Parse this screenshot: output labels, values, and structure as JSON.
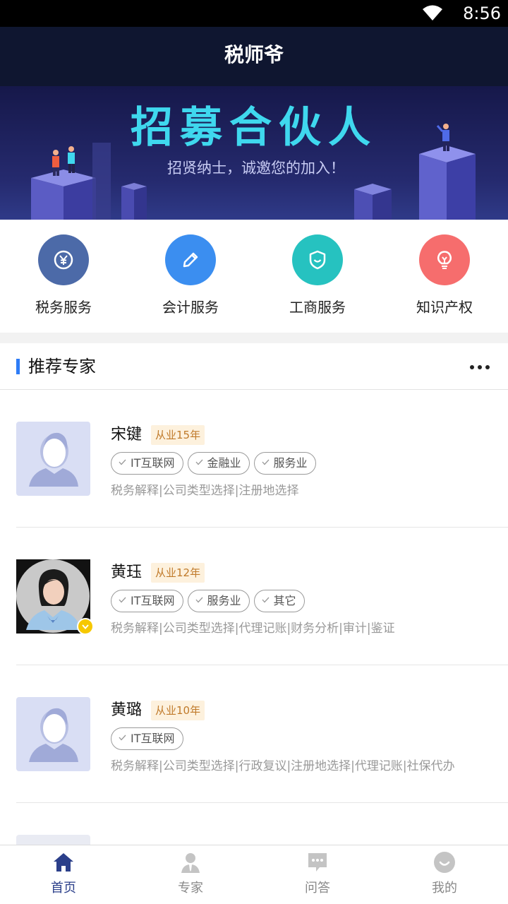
{
  "status": {
    "time": "8:56",
    "wifi_icon": "wifi-icon"
  },
  "header": {
    "title": "税师爷"
  },
  "banner": {
    "headline": "招募合伙人",
    "subline": "招贤纳士，诚邀您的加入！"
  },
  "services": [
    {
      "label": "税务服务",
      "icon": "yen-icon",
      "color": "#4c6aa8"
    },
    {
      "label": "会计服务",
      "icon": "pencil-icon",
      "color": "#3b8ef0"
    },
    {
      "label": "工商服务",
      "icon": "shield-icon",
      "color": "#26c2c0"
    },
    {
      "label": "知识产权",
      "icon": "lightbulb-icon",
      "color": "#f66d6d"
    }
  ],
  "experts_section": {
    "title": "推荐专家",
    "more_icon": "more-icon"
  },
  "experts": [
    {
      "name": "宋键",
      "years": "从业15年",
      "tags": [
        "IT互联网",
        "金融业",
        "服务业"
      ],
      "desc": "税务解释|公司类型选择|注册地选择"
    },
    {
      "name": "黄珏",
      "years": "从业12年",
      "tags": [
        "IT互联网",
        "服务业",
        "其它"
      ],
      "desc": "税务解释|公司类型选择|代理记账|财务分析|审计|鉴证"
    },
    {
      "name": "黄璐",
      "years": "从业10年",
      "tags": [
        "IT互联网"
      ],
      "desc": "税务解释|公司类型选择|行政复议|注册地选择|代理记账|社保代办"
    }
  ],
  "tabbar": [
    {
      "label": "首页",
      "icon": "home-icon",
      "active": true
    },
    {
      "label": "专家",
      "icon": "expert-icon",
      "active": false
    },
    {
      "label": "问答",
      "icon": "chat-icon",
      "active": false
    },
    {
      "label": "我的",
      "icon": "profile-icon",
      "active": false
    }
  ],
  "colors": {
    "accent": "#2e7cf6",
    "tab_active": "#2b3f8a",
    "years_bg": "#fdf1dd",
    "years_text": "#c07a2a"
  }
}
